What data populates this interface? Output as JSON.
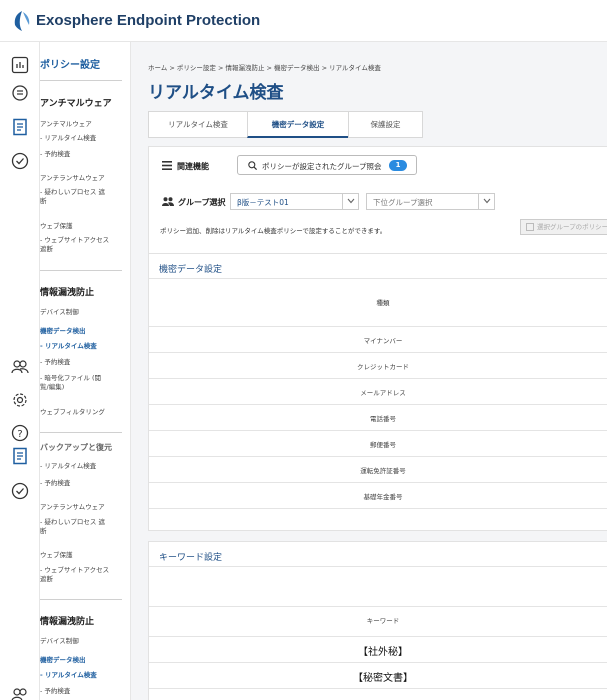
{
  "app": {
    "title": "Exosphere Endpoint Protection",
    "brand_color": "#1f5fa0"
  },
  "rail": {
    "icons": [
      "chart-icon",
      "search-doc-icon",
      "document-icon",
      "check-circle-icon",
      "users-icon",
      "gear-icon",
      "help-icon",
      "policy-doc-icon",
      "check-circle-icon"
    ]
  },
  "sidebar": {
    "title": "ポリシー設定",
    "group1": {
      "head": "アンチマルウェア",
      "cat1": "アンチマルウェア",
      "cat1_items": [
        "- リアルタイム検査",
        "- 予約検査"
      ],
      "cat2": "アンチランサムウェア",
      "cat2_items": [
        "- 疑わしいプロセス 遮断"
      ],
      "cat3": "ウェブ保護",
      "cat3_items": [
        "- ウェブサイトアクセス 遮断"
      ]
    },
    "group2": {
      "head": "情報漏洩防止",
      "cat1": "デバイス制御",
      "cat2": "機密データ検出",
      "cat2_items": [
        "- リアルタイム検査",
        "- 予約検査",
        "- 暗号化ファイル (閲覧/編集)"
      ],
      "cat3": "ウェブフィルタリング"
    },
    "group3": {
      "head": "バックアップと復元",
      "items": [
        "- リアルタイム検査",
        "- 予約検査"
      ],
      "cat1": "アンチランサムウェア",
      "cat1_items": [
        "- 疑わしいプロセス 遮断"
      ],
      "cat2": "ウェブ保護",
      "cat2_items": [
        "- ウェブサイトアクセス 遮断"
      ]
    },
    "group4": {
      "head": "情報漏洩防止",
      "cat1": "デバイス制御",
      "cat2": "機密データ検出",
      "items": [
        "- リアルタイム検査",
        "- 予約検査"
      ]
    }
  },
  "breadcrumb": "ホーム > ポリシー設定 > 情報漏洩防止 > 機密データ検出 > リアルタイム検査",
  "page_title": "リアルタイム検査",
  "tabs": [
    {
      "label": "リアルタイム検査",
      "active": false
    },
    {
      "label": "機密データ設定",
      "active": true
    },
    {
      "label": "保護設定",
      "active": false
    }
  ],
  "toolbar": {
    "related_label": "関連機能",
    "related_button": "ポリシーが設定されたグループ照会",
    "related_count": "1",
    "group_label": "グループ選択",
    "group_value": "β版－テスト01",
    "subgroup_placeholder": "下位グループ選択",
    "note": "ポリシー追加、削除はリアルタイム検査ポリシーで設定することができます。",
    "disabled_button": "選択グループのポリシー"
  },
  "sensitive_section": {
    "title": "機密データ設定",
    "column": "種類",
    "rows": [
      "マイナンバー",
      "クレジットカード",
      "メールアドレス",
      "電話番号",
      "郵便番号",
      "運転免許証番号",
      "基礎年金番号"
    ]
  },
  "keyword_section": {
    "title": "キーワード設定",
    "column": "キーワード",
    "rows": [
      "【社外秘】",
      "【秘密文書】"
    ]
  }
}
